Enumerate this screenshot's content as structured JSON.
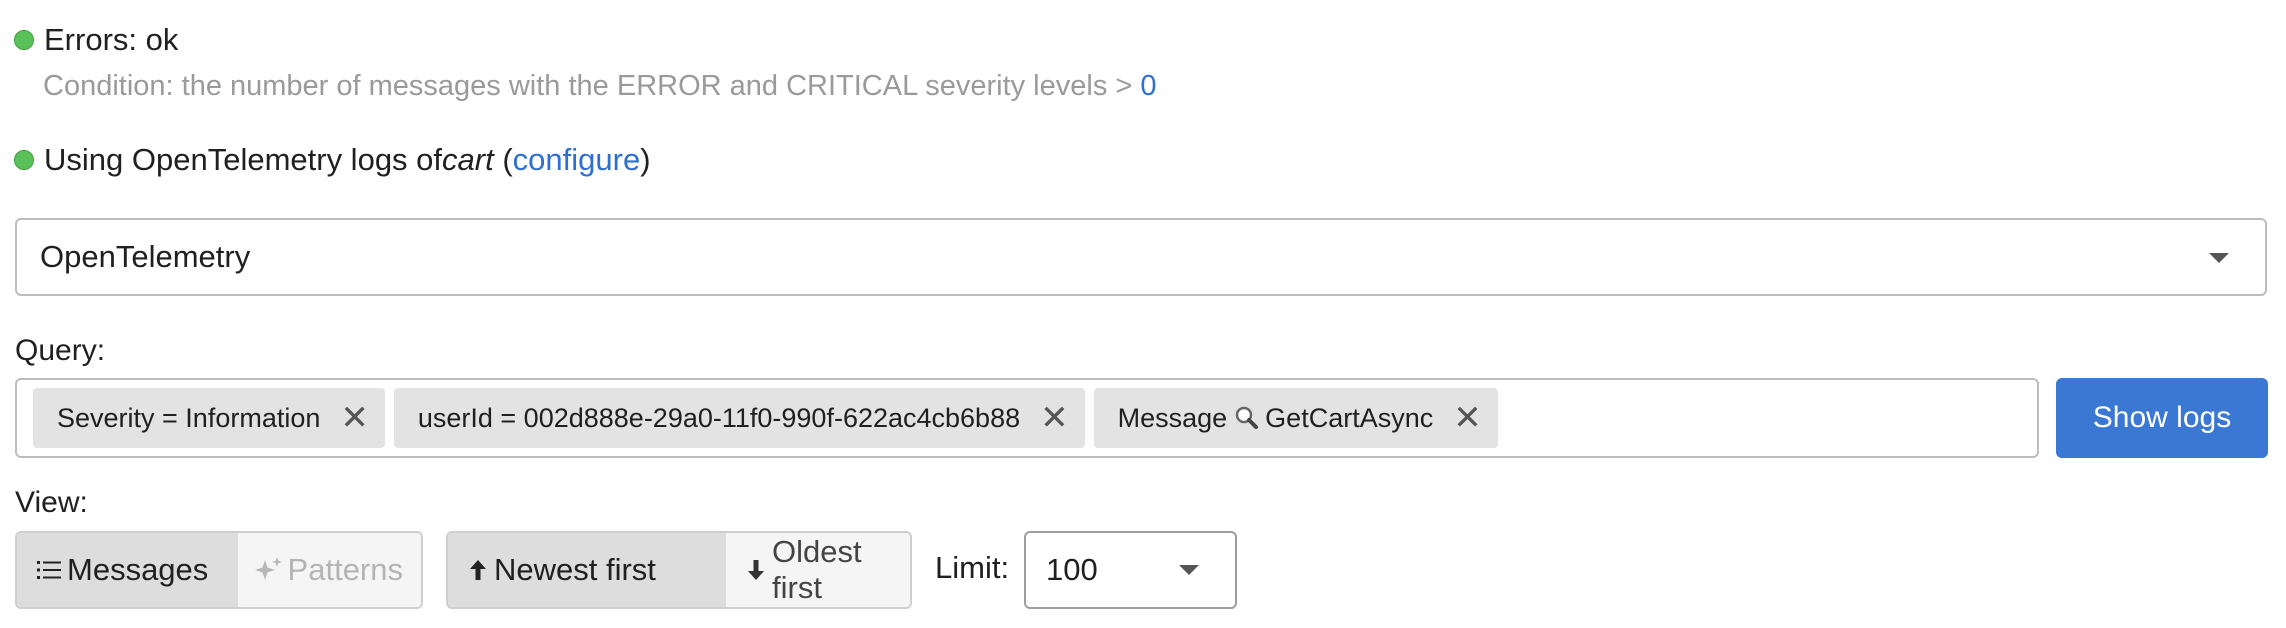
{
  "status": {
    "errors_label": "Errors: ok",
    "condition_text": "Condition: the number of messages with the ERROR and CRITICAL severity levels > ",
    "condition_value": "0",
    "source_prefix": "Using OpenTelemetry logs of ",
    "source_app": "cart",
    "source_open_paren": " (",
    "configure_link": "configure",
    "source_close_paren": ")",
    "status_color": "#5bc25b"
  },
  "source_select": {
    "value": "OpenTelemetry"
  },
  "query": {
    "label": "Query:",
    "chips": [
      {
        "text": "Severity = Information"
      },
      {
        "text": "userId = 002d888e-29a0-11f0-990f-622ac4cb6b88"
      },
      {
        "field": "Message",
        "value": "GetCartAsync"
      }
    ],
    "show_logs_label": "Show logs",
    "accent_color": "#3a78d4"
  },
  "view": {
    "label": "View:",
    "messages_label": "Messages",
    "patterns_label": "Patterns",
    "newest_label": "Newest first",
    "oldest_label": "Oldest first"
  },
  "limit": {
    "label": "Limit:",
    "value": "100"
  }
}
